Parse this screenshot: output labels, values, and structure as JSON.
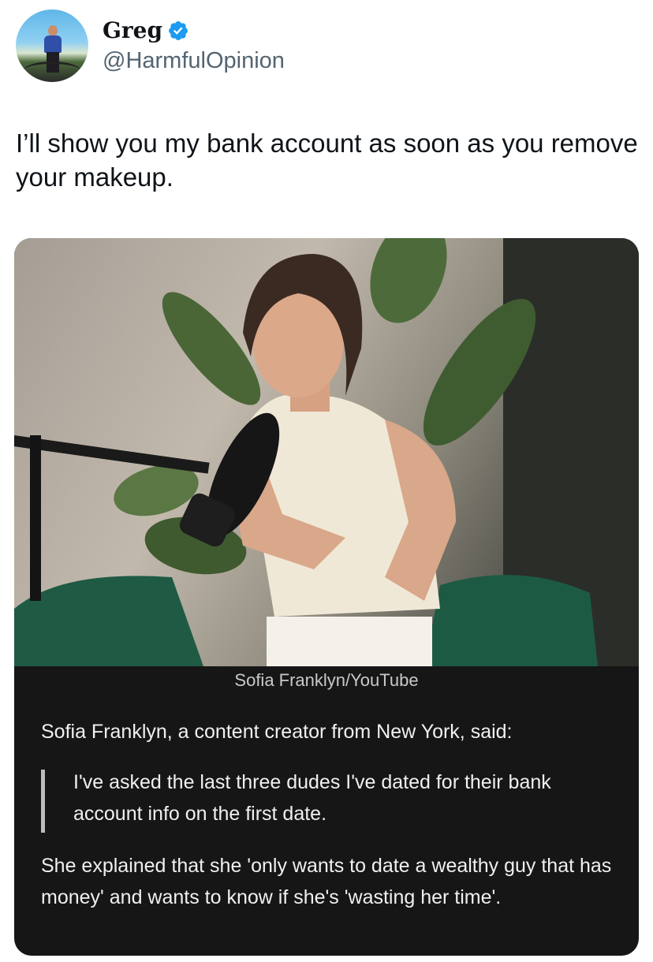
{
  "author": {
    "name": "Greg",
    "handle": "@HarmfulOpinion",
    "verified": true,
    "verified_color": "#1d9bf0"
  },
  "tweet": {
    "text": "I’ll show you my bank account as soon as you remove your makeup."
  },
  "card": {
    "photo_credit": "Sofia Franklyn/YouTube",
    "lede": "Sofia Franklyn, a content creator from New York, said:",
    "quote": "I've asked the last three dudes I've dated for their bank account info on the first date.",
    "body": "She explained that she 'only wants to date a wealthy guy that has money' and wants to know if she's 'wasting her time'."
  },
  "icons": {
    "verified": "verified-badge-icon"
  }
}
